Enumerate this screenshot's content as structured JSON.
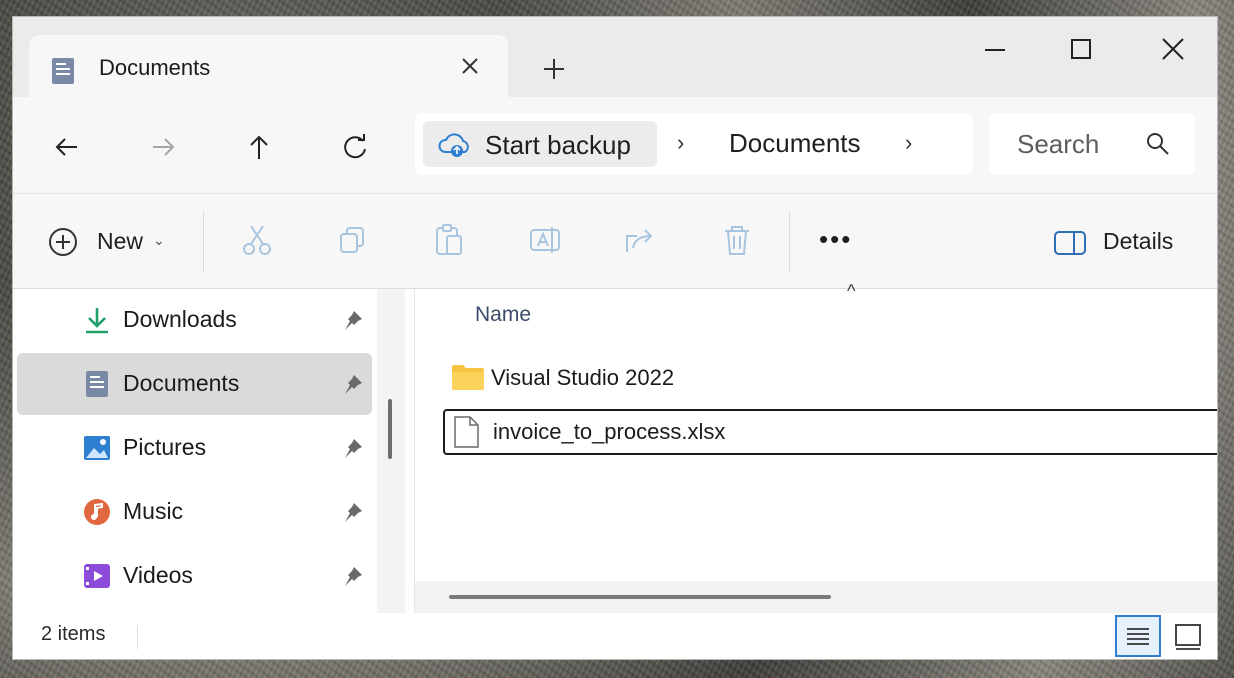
{
  "window": {
    "tab_title": "Documents",
    "new_tab_glyph": "+",
    "controls": [
      "minimize-icon",
      "maximize-icon",
      "close-icon"
    ]
  },
  "address": {
    "backup_label": "Start backup",
    "crumbs": [
      "Documents"
    ],
    "separator": "›",
    "search_placeholder": "Search"
  },
  "toolbar": {
    "new_label": "New",
    "new_caret": "⌄",
    "more_label": "•••",
    "details_label": "Details",
    "icons": [
      "cut-icon",
      "copy-icon",
      "paste-icon",
      "rename-icon",
      "share-icon",
      "delete-icon"
    ]
  },
  "sidebar": {
    "items": [
      {
        "label": "Downloads",
        "icon": "download-icon"
      },
      {
        "label": "Documents",
        "icon": "documents-icon",
        "active": true
      },
      {
        "label": "Pictures",
        "icon": "pictures-icon"
      },
      {
        "label": "Music",
        "icon": "music-icon"
      },
      {
        "label": "Videos",
        "icon": "videos-icon"
      }
    ]
  },
  "files": {
    "column_name": "Name",
    "sort_caret": "^",
    "rows": [
      {
        "name": "Visual Studio 2022",
        "type": "folder"
      },
      {
        "name": "invoice_to_process.xlsx",
        "type": "file"
      }
    ]
  },
  "status": {
    "items_count": "2 items"
  },
  "colors": {
    "accent": "#2f7fd0",
    "folder": "#f6c342",
    "selection": "#dadada"
  }
}
